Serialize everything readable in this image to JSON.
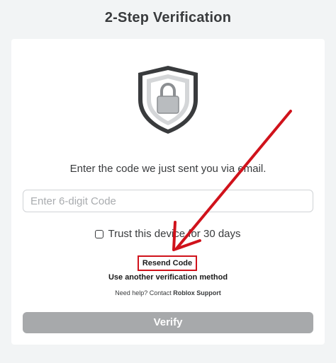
{
  "header": {
    "title": "2-Step Verification"
  },
  "card": {
    "icon": "shield-lock-icon",
    "instruction": "Enter the code we just sent you via email.",
    "code_input": {
      "placeholder": "Enter 6-digit Code",
      "value": ""
    },
    "trust_device": {
      "label": "Trust this device for 30 days",
      "checked": false
    },
    "resend_label": "Resend Code",
    "alt_method_label": "Use another verification method",
    "help": {
      "prefix": "Need help? Contact ",
      "link": "Roblox Support"
    },
    "verify_label": "Verify"
  },
  "annotation": {
    "icon": "red-arrow-icon",
    "color": "#d0121b"
  },
  "colors": {
    "background": "#f2f4f5",
    "card": "#ffffff",
    "verify_button": "#a7a9ab",
    "highlight": "#d0121b"
  }
}
